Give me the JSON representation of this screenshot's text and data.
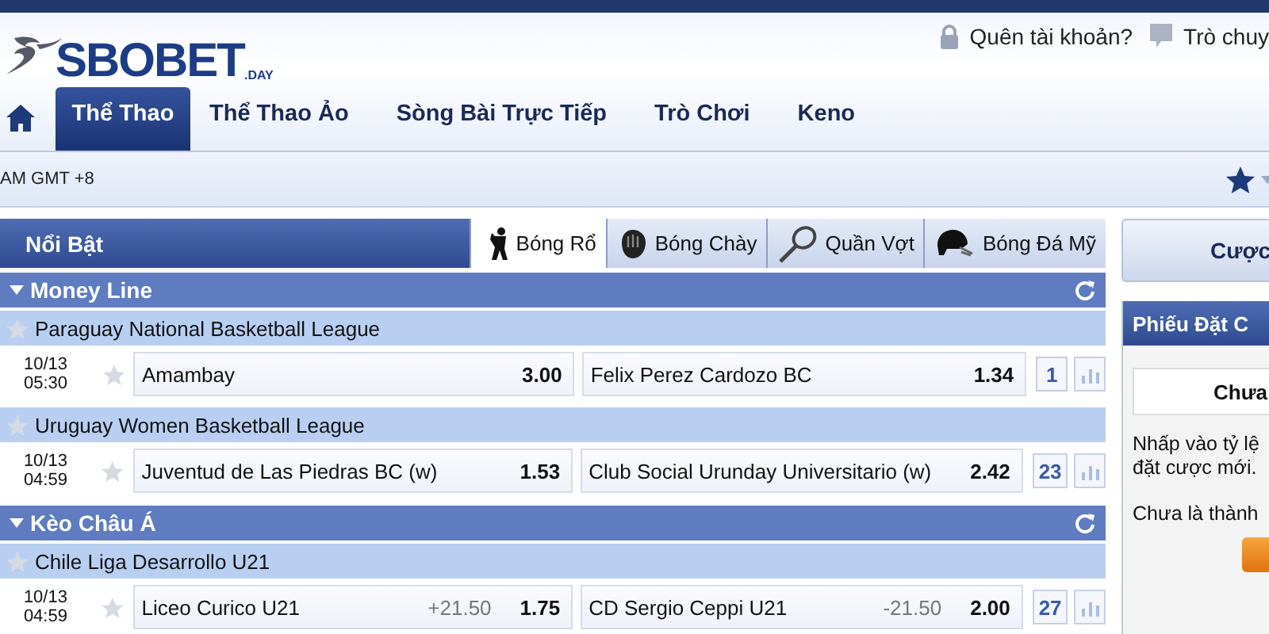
{
  "top_links": [
    {
      "label": "Quên tài khoản?"
    },
    {
      "label": "Trò chuy"
    }
  ],
  "logo": {
    "name": "SBOBET",
    "suffix": ".DAY"
  },
  "nav": [
    {
      "label": "Thể Thao",
      "selected": true
    },
    {
      "label": "Thể Thao Ảo",
      "selected": false
    },
    {
      "label": "Sòng Bài Trực Tiếp",
      "selected": false
    },
    {
      "label": "Trò Chơi",
      "selected": false
    },
    {
      "label": "Keno",
      "selected": false
    }
  ],
  "time_text": "AM GMT +8",
  "highlights": {
    "title": "Nổi Bật",
    "sport_tabs": [
      {
        "label": "Bóng Rổ",
        "selected": true
      },
      {
        "label": "Bóng Chày",
        "selected": false
      },
      {
        "label": "Quần Vợt",
        "selected": false
      },
      {
        "label": "Bóng Đá Mỹ",
        "selected": false
      }
    ]
  },
  "sections": [
    {
      "title": "Money Line",
      "leagues": [
        {
          "name": "Paraguay National Basketball League",
          "matches": [
            {
              "date": "10/13",
              "time": "05:30",
              "home": "Amambay",
              "home_odds": "3.00",
              "away": "Felix Perez Cardozo BC",
              "away_odds": "1.34",
              "count": "1"
            }
          ]
        },
        {
          "name": "Uruguay Women Basketball League",
          "matches": [
            {
              "date": "10/13",
              "time": "04:59",
              "home": "Juventud de Las Piedras BC (w)",
              "home_odds": "1.53",
              "away": "Club Social Urunday Universitario (w)",
              "away_odds": "2.42",
              "count": "23"
            }
          ]
        }
      ]
    },
    {
      "title": "Kèo Châu Á",
      "leagues": [
        {
          "name": "Chile Liga Desarrollo U21",
          "matches": [
            {
              "date": "10/13",
              "time": "04:59",
              "home": "Liceo Curico U21",
              "home_hcp": "+21.50",
              "home_odds": "1.75",
              "away": "CD Sergio Ceppi U21",
              "away_hcp": "-21.50",
              "away_odds": "2.00",
              "count": "27"
            }
          ]
        }
      ]
    }
  ],
  "bet_panel": {
    "button": "Cược",
    "slip_title": "Phiếu Đặt C",
    "box_text": "Chưa",
    "hint_lines": [
      "Nhấp vào tỷ lệ",
      "đặt cược mới."
    ],
    "member_text": "Chưa là thành"
  }
}
